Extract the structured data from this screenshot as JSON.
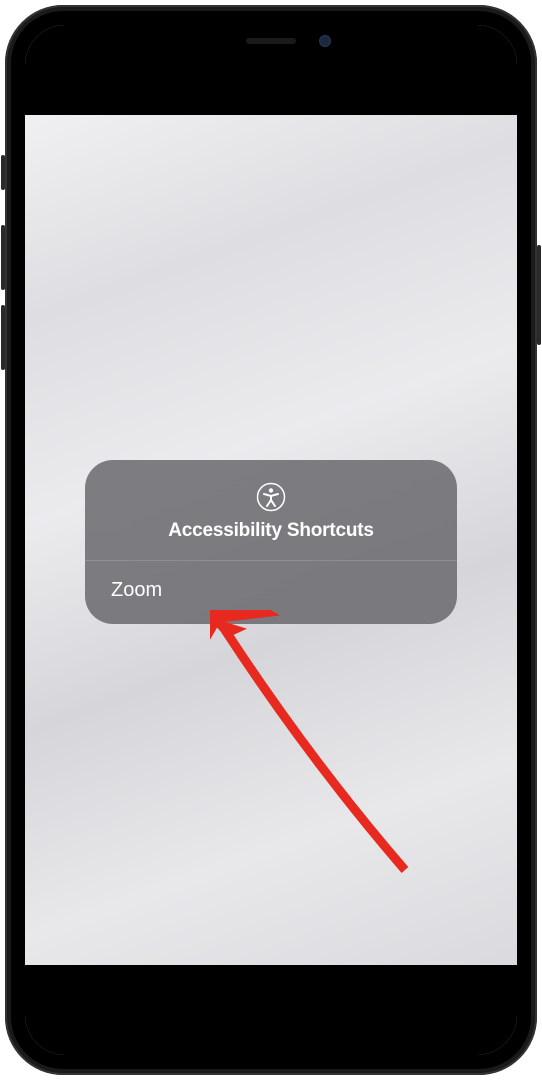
{
  "popup": {
    "title": "Accessibility Shortcuts",
    "items": [
      {
        "label": "Zoom"
      }
    ]
  },
  "icons": {
    "accessibility": "accessibility-icon"
  }
}
